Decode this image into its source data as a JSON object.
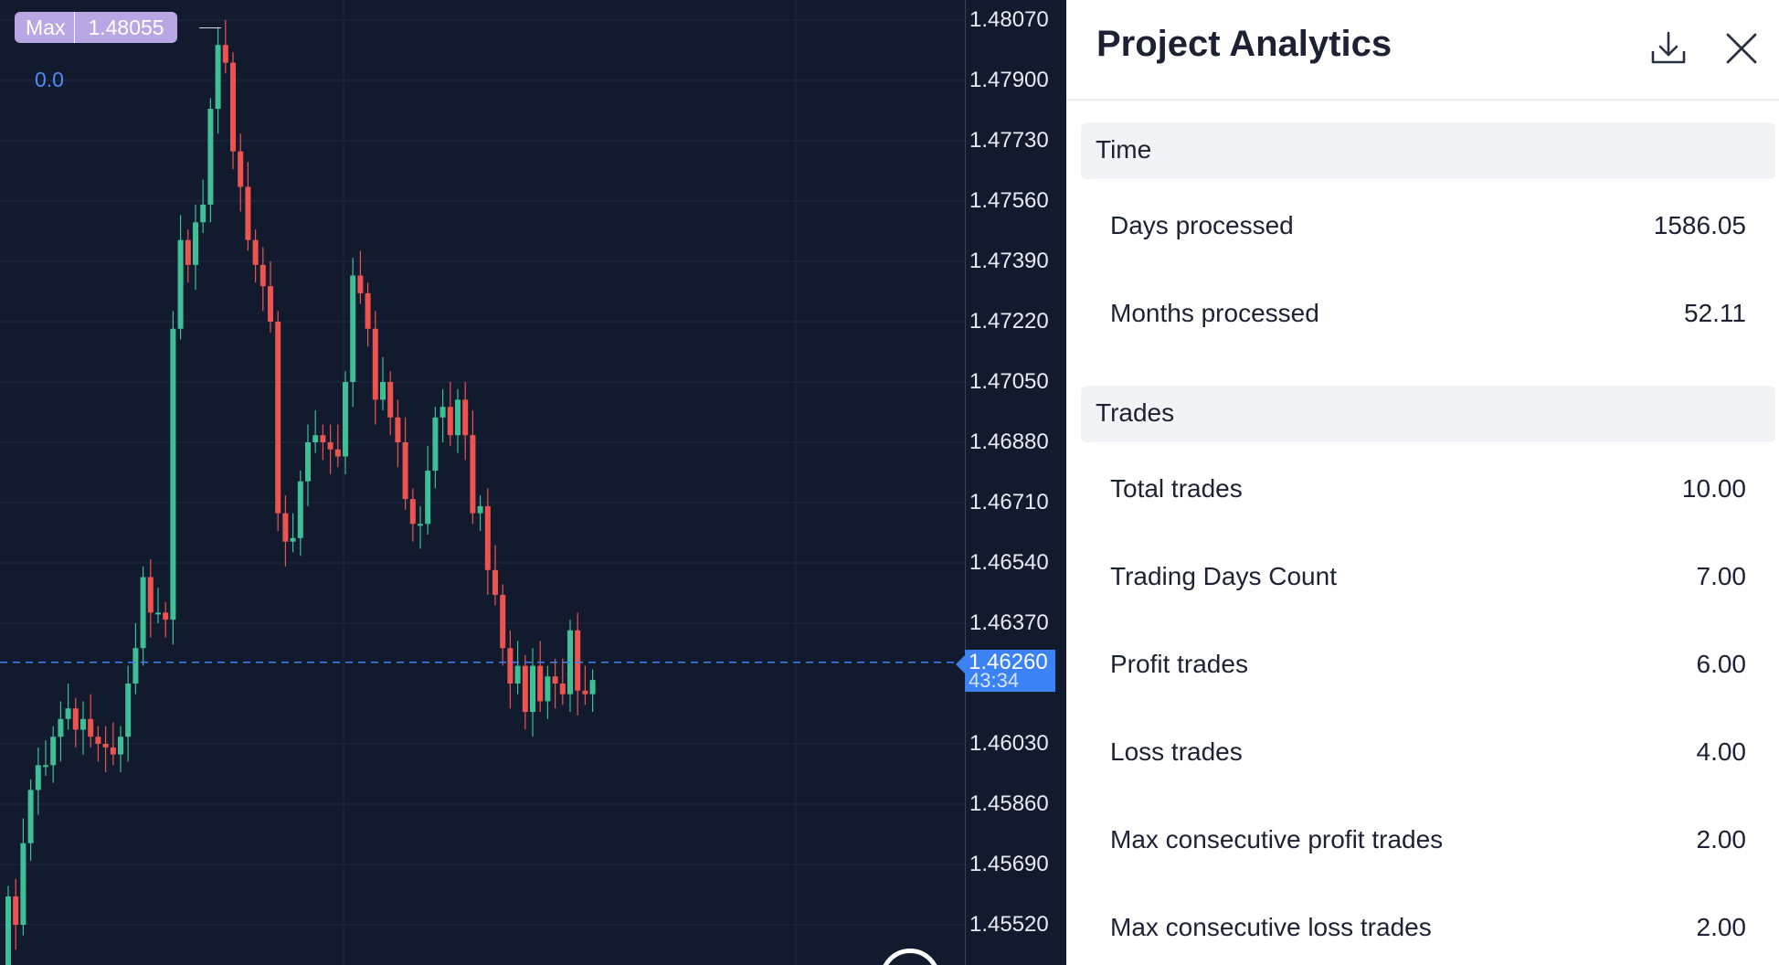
{
  "chart": {
    "price_ticks": [
      "1.48070",
      "1.47900",
      "1.47730",
      "1.47560",
      "1.47390",
      "1.47220",
      "1.47050",
      "1.46880",
      "1.46710",
      "1.46540",
      "1.46370",
      "1.46030",
      "1.45860",
      "1.45690",
      "1.45520"
    ],
    "current_price": "1.46260",
    "countdown": "43:34",
    "max_label": "Max",
    "max_value": "1.48055",
    "indicator_value": "0.0",
    "colors": {
      "up": "#3fbf95",
      "down": "#ef5350",
      "background": "#121a2e",
      "grid": "#1f2940",
      "current_price_line": "#3b82f6"
    }
  },
  "panel": {
    "title": "Project Analytics",
    "sections": {
      "time": {
        "header": "Time",
        "rows": [
          {
            "label": "Days processed",
            "value": "1586.05"
          },
          {
            "label": "Months processed",
            "value": "52.11"
          }
        ]
      },
      "trades": {
        "header": "Trades",
        "rows": [
          {
            "label": "Total trades",
            "value": "10.00"
          },
          {
            "label": "Trading Days Count",
            "value": "7.00"
          },
          {
            "label": "Profit trades",
            "value": "6.00"
          },
          {
            "label": "Loss trades",
            "value": "4.00"
          },
          {
            "label": "Max consecutive profit trades",
            "value": "2.00"
          },
          {
            "label": "Max consecutive loss trades",
            "value": "2.00"
          }
        ]
      }
    },
    "icons": {
      "download": "download-icon",
      "close": "close-icon"
    }
  }
}
